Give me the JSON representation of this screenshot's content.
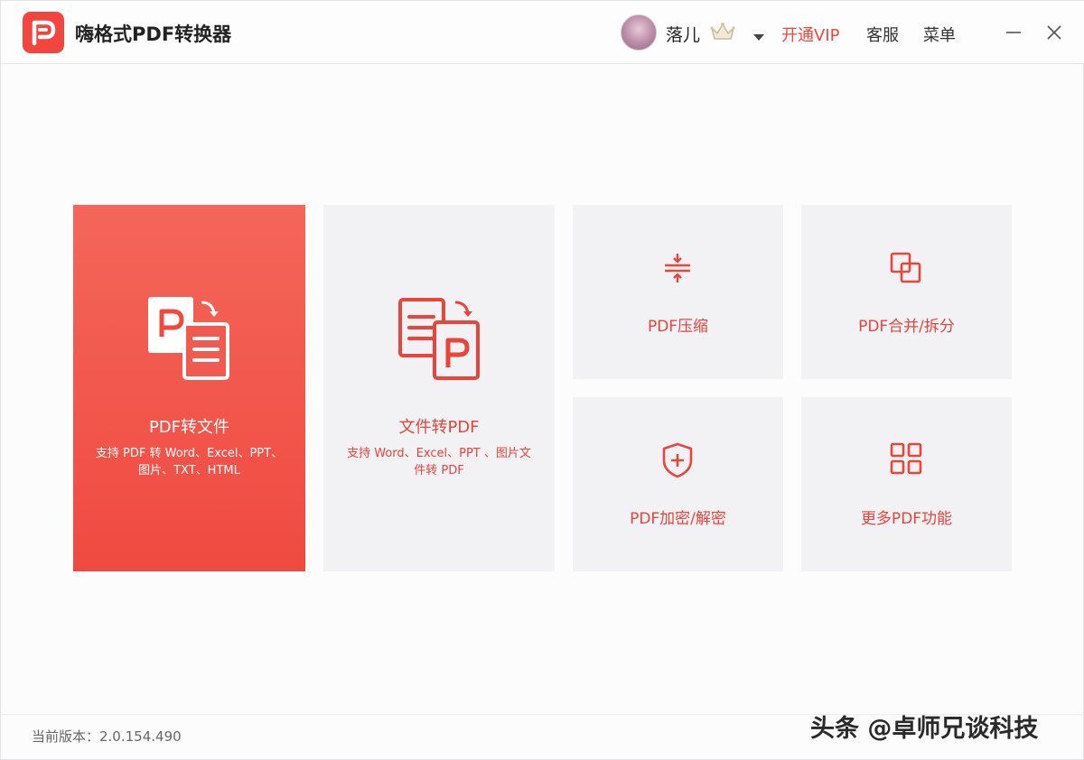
{
  "app": {
    "title": "嗨格式PDF转换器"
  },
  "header": {
    "username": "落儿",
    "vip_label": "开通VIP",
    "service_label": "客服",
    "menu_label": "菜单"
  },
  "tiles": {
    "pdf_to_file": {
      "title": "PDF转文件",
      "desc": "支持 PDF 转 Word、Excel、PPT、图片、TXT、HTML"
    },
    "file_to_pdf": {
      "title": "文件转PDF",
      "desc": "支持 Word、Excel、PPT 、图片文件转 PDF"
    },
    "compress": {
      "label": "PDF压缩"
    },
    "merge_split": {
      "label": "PDF合并/拆分"
    },
    "encrypt": {
      "label": "PDF加密/解密"
    },
    "more": {
      "label": "更多PDF功能"
    }
  },
  "footer": {
    "version": "当前版本：2.0.154.490"
  },
  "watermark": "头条 @卓师兄谈科技",
  "colors": {
    "accent": "#f2453d",
    "tile_bg": "#f2f2f4"
  },
  "icons": {
    "logo": "pdf-logo-icon",
    "crown": "crown-icon",
    "compress": "compress-icon",
    "merge": "merge-icon",
    "encrypt": "shield-plus-icon",
    "more": "grid-icon"
  }
}
